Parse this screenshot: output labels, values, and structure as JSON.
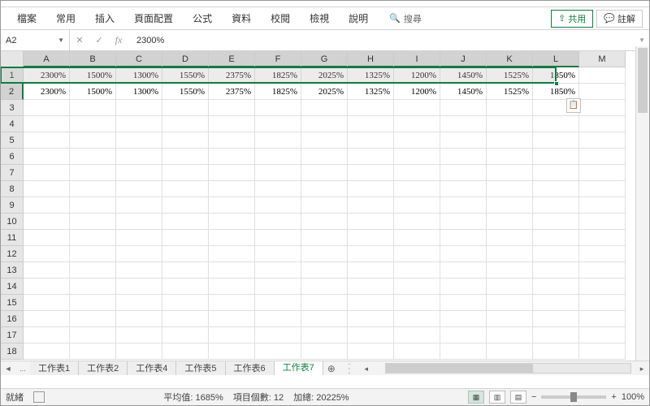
{
  "ribbon": {
    "tabs": [
      "檔案",
      "常用",
      "插入",
      "頁面配置",
      "公式",
      "資料",
      "校閱",
      "檢視",
      "說明"
    ],
    "search_label": "搜尋",
    "share_label": "共用",
    "comment_label": "註解"
  },
  "formula_bar": {
    "name_box": "A2",
    "cancel": "✕",
    "confirm": "✓",
    "fx": "fx",
    "value": "2300%"
  },
  "columns": [
    "A",
    "B",
    "C",
    "D",
    "E",
    "F",
    "G",
    "H",
    "I",
    "J",
    "K",
    "L",
    "M"
  ],
  "selected_cols": [
    "A",
    "B",
    "C",
    "D",
    "E",
    "F",
    "G",
    "H",
    "I",
    "J",
    "K",
    "L"
  ],
  "row_count": 18,
  "selected_row": 2,
  "data_rows": [
    [
      "2300%",
      "1500%",
      "1300%",
      "1550%",
      "2375%",
      "1825%",
      "2025%",
      "1325%",
      "1200%",
      "1450%",
      "1525%",
      "1850%",
      ""
    ],
    [
      "2300%",
      "1500%",
      "1300%",
      "1550%",
      "2375%",
      "1825%",
      "2025%",
      "1325%",
      "1200%",
      "1450%",
      "1525%",
      "1850%",
      ""
    ]
  ],
  "sheet_tabs": {
    "overflow": "...",
    "tabs": [
      "工作表1",
      "工作表2",
      "工作表4",
      "工作表5",
      "工作表6",
      "工作表7"
    ],
    "active": "工作表7"
  },
  "status": {
    "ready": "就緒",
    "avg": "平均值: 1685%",
    "count": "項目個數: 12",
    "sum": "加總: 20225%",
    "zoom": "100%"
  }
}
